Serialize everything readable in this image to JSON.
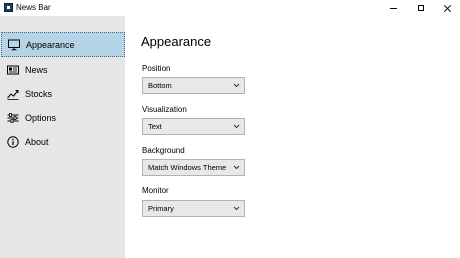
{
  "window": {
    "title": "News Bar"
  },
  "sidebar": {
    "items": [
      {
        "label": "Appearance",
        "icon": "monitor-icon",
        "selected": true
      },
      {
        "label": "News",
        "icon": "newspaper-icon",
        "selected": false
      },
      {
        "label": "Stocks",
        "icon": "stock-chart-icon",
        "selected": false
      },
      {
        "label": "Options",
        "icon": "sliders-icon",
        "selected": false
      },
      {
        "label": "About",
        "icon": "info-icon",
        "selected": false
      }
    ]
  },
  "main": {
    "title": "Appearance",
    "fields": [
      {
        "label": "Position",
        "value": "Bottom"
      },
      {
        "label": "Visualization",
        "value": "Text"
      },
      {
        "label": "Background",
        "value": "Match Windows Theme"
      },
      {
        "label": "Monitor",
        "value": "Primary"
      }
    ]
  },
  "colors": {
    "sidebar_bg": "#e6e6e6",
    "selected_bg": "#b6d4e8",
    "dropdown_bg": "#e8e8e8"
  }
}
